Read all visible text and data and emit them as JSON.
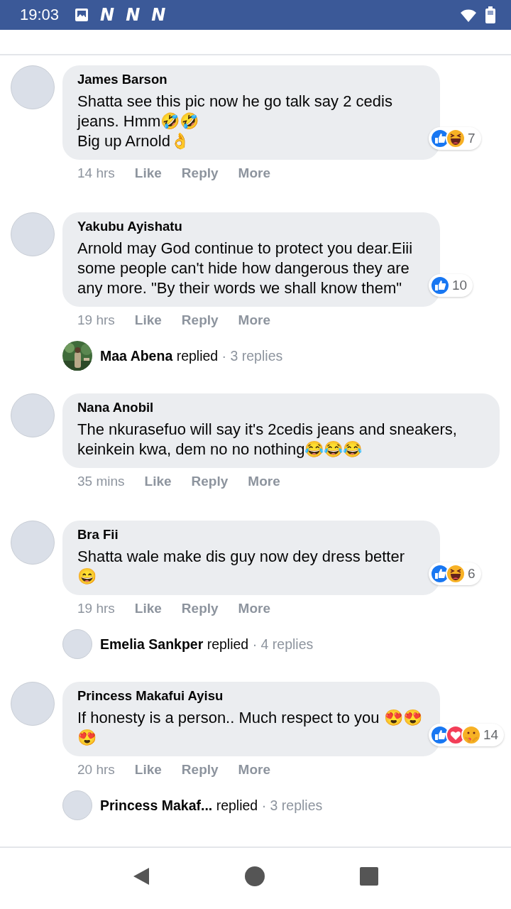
{
  "status_bar": {
    "time": "19:03",
    "notification_icons": [
      "N",
      "N",
      "N"
    ]
  },
  "comments": [
    {
      "kind": "comment",
      "author": "James Barson",
      "text": "Shatta see this pic now he go talk say 2 cedis jeans. Hmm🤣🤣\nBig up Arnold👌",
      "time": "14 hrs",
      "actions": [
        "Like",
        "Reply",
        "More"
      ],
      "reactions": [
        {
          "kind": "like"
        },
        {
          "kind": "haha"
        }
      ],
      "reaction_count": "7"
    },
    {
      "kind": "comment",
      "author": "Yakubu Ayishatu",
      "text": "Arnold may God continue to protect you dear.Eiii some people can't hide how dangerous they are any more. \"By their words we shall know them\"",
      "time": "19 hrs",
      "actions": [
        "Like",
        "Reply",
        "More"
      ],
      "reactions": [
        {
          "kind": "like"
        }
      ],
      "reaction_count": "10"
    },
    {
      "kind": "reply_summary",
      "author": "Maa Abena",
      "verb": "replied",
      "count": "· 3 replies"
    },
    {
      "kind": "comment",
      "author": "Nana Anobil",
      "text": "The nkurasefuo will say it's 2cedis jeans and sneakers, keinkein kwa, dem no no nothing😂😂😂",
      "time": "35 mins",
      "actions": [
        "Like",
        "Reply",
        "More"
      ]
    },
    {
      "kind": "comment",
      "author": "Bra Fii",
      "text": "Shatta wale make dis guy now dey dress better 😄",
      "time": "19 hrs",
      "actions": [
        "Like",
        "Reply",
        "More"
      ],
      "reactions": [
        {
          "kind": "like"
        },
        {
          "kind": "haha"
        }
      ],
      "reaction_count": "6"
    },
    {
      "kind": "reply_summary",
      "avatar": {
        "kind": "plain"
      },
      "author": "Emelia Sankper",
      "verb": "replied",
      "count": "· 4 replies"
    },
    {
      "kind": "comment",
      "author": "Princess Makafui Ayisu",
      "text": "If honesty is a person.. Much respect to you 😍😍😍",
      "time": "20 hrs",
      "actions": [
        "Like",
        "Reply",
        "More"
      ],
      "reactions": [
        {
          "kind": "like"
        },
        {
          "kind": "love"
        },
        {
          "kind": "care"
        }
      ],
      "reaction_count": "14"
    },
    {
      "kind": "reply_summary",
      "avatar": {
        "kind": "plain"
      },
      "author": "Princess Makaf...",
      "verb": "replied",
      "count": "· 3 replies"
    }
  ]
}
